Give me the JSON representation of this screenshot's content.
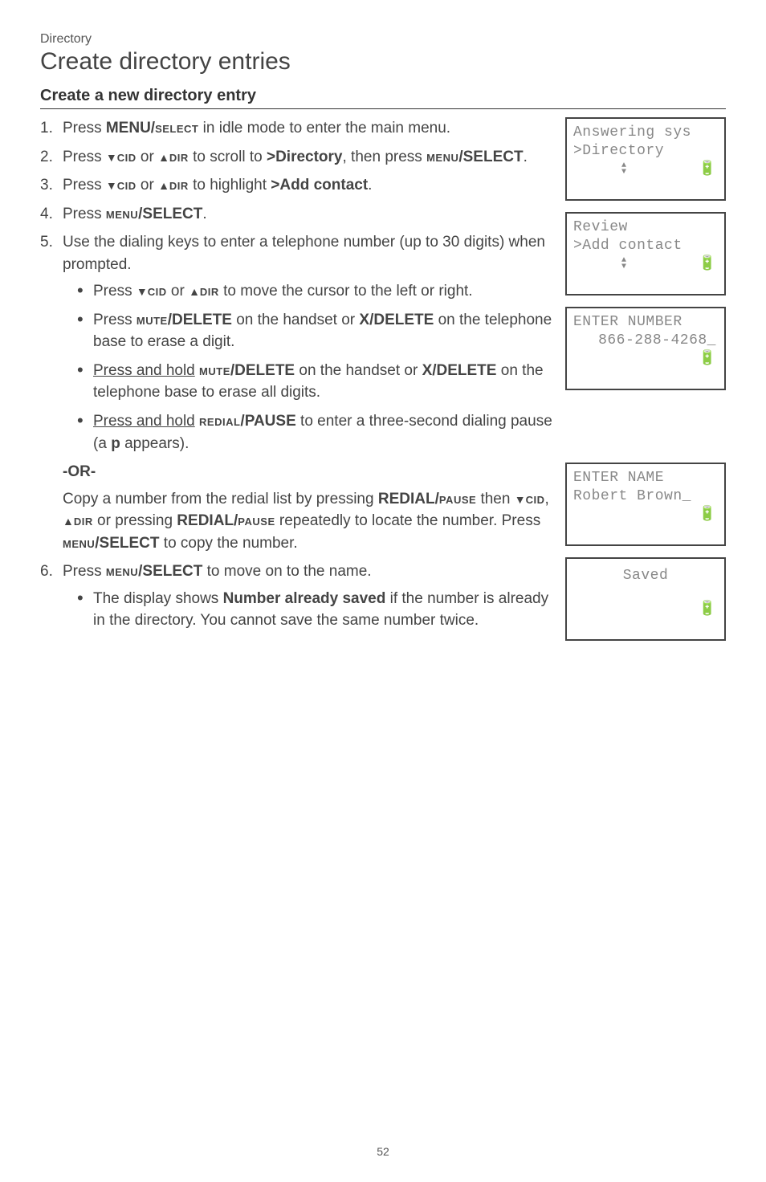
{
  "breadcrumb": "Directory",
  "title": "Create directory entries",
  "section": "Create a new directory entry",
  "steps": {
    "s1": {
      "num": "1.",
      "text_pre": "Press ",
      "b1": "MENU/",
      "sc1": "select",
      "text_post": " in idle mode to enter the main menu."
    },
    "s2": {
      "num": "2.",
      "text_a": "Press ",
      "sc_cid": "cid",
      "text_b": " or ",
      "sc_dir": "dir",
      "text_c": " to scroll to ",
      "b_dir": ">Directory",
      "text_d": ", then press ",
      "sc_menu": "menu",
      "b_sel": "/SELECT",
      "text_e": "."
    },
    "s3": {
      "num": "3.",
      "text_a": "Press ",
      "sc_cid": "cid",
      "text_b": " or ",
      "sc_dir": "dir",
      "text_c": " to highlight ",
      "b_add": ">Add contact",
      "text_d": "."
    },
    "s4": {
      "num": "4.",
      "text_a": "Press ",
      "sc_menu": "menu",
      "b_sel": "/SELECT",
      "text_b": "."
    },
    "s5": {
      "num": "5.",
      "text": "Use the dialing keys to enter a telephone number (up to 30 digits) when prompted."
    },
    "s5a": {
      "text_a": "Press ",
      "sc_cid": "cid",
      "text_b": " or ",
      "sc_dir": "dir",
      "text_c": " to move the cursor to the left or right."
    },
    "s5b": {
      "text_a": "Press ",
      "sc_mute": "mute",
      "b_del": "/DELETE",
      "text_b": " on the handset or ",
      "b_xdel": "X/DELETE",
      "text_c": " on the telephone base to erase a digit."
    },
    "s5c": {
      "u": "Press and hold",
      "text_a": " ",
      "sc_mute": "mute",
      "b_del": "/DELETE",
      "text_b": " on the handset or ",
      "b_xdel": "X/DELETE",
      "text_c": " on the telephone base to erase all digits."
    },
    "s5d": {
      "u": "Press and hold",
      "text_a": " ",
      "sc_red": "redial",
      "b_pause": "/PAUSE",
      "text_b": " to enter a three-second dialing pause (a ",
      "b_p": "p",
      "text_c": " appears)."
    },
    "or": "-OR-",
    "copy": {
      "text_a": "Copy a number from the redial list by pressing ",
      "b_red": "REDIAL/",
      "sc_pause": "pause",
      "text_b": " then ",
      "sc_cid": "cid",
      "text_c": ", ",
      "sc_dir": "dir",
      "text_d": " or pressing ",
      "b_red2": "REDIAL/",
      "sc_pause2": "pause",
      "text_e": " repeatedly to locate the number. Press ",
      "sc_menu": "menu",
      "b_sel": "/SELECT",
      "text_f": " to copy the number."
    },
    "s6": {
      "num": "6.",
      "text_a": "Press ",
      "sc_menu": "menu",
      "b_sel": "/SELECT",
      "text_b": " to move on to the name."
    },
    "s6a": {
      "text_a": "The display shows ",
      "b_already": "Number already saved",
      "text_b": " if the number is already in the directory. You cannot save the same number twice."
    }
  },
  "screens": {
    "sc1": {
      "line1": " Answering sys",
      "line2": ">Directory"
    },
    "sc2": {
      "line1": " Review",
      "line2": ">Add contact"
    },
    "sc3": {
      "line1": "ENTER NUMBER",
      "line2": "866-288-4268_"
    },
    "sc4": {
      "line1": "ENTER NAME",
      "line2": "Robert Brown_"
    },
    "sc5": {
      "line1": "Saved"
    }
  },
  "icons": {
    "battery": "🔋"
  },
  "page_number": "52"
}
